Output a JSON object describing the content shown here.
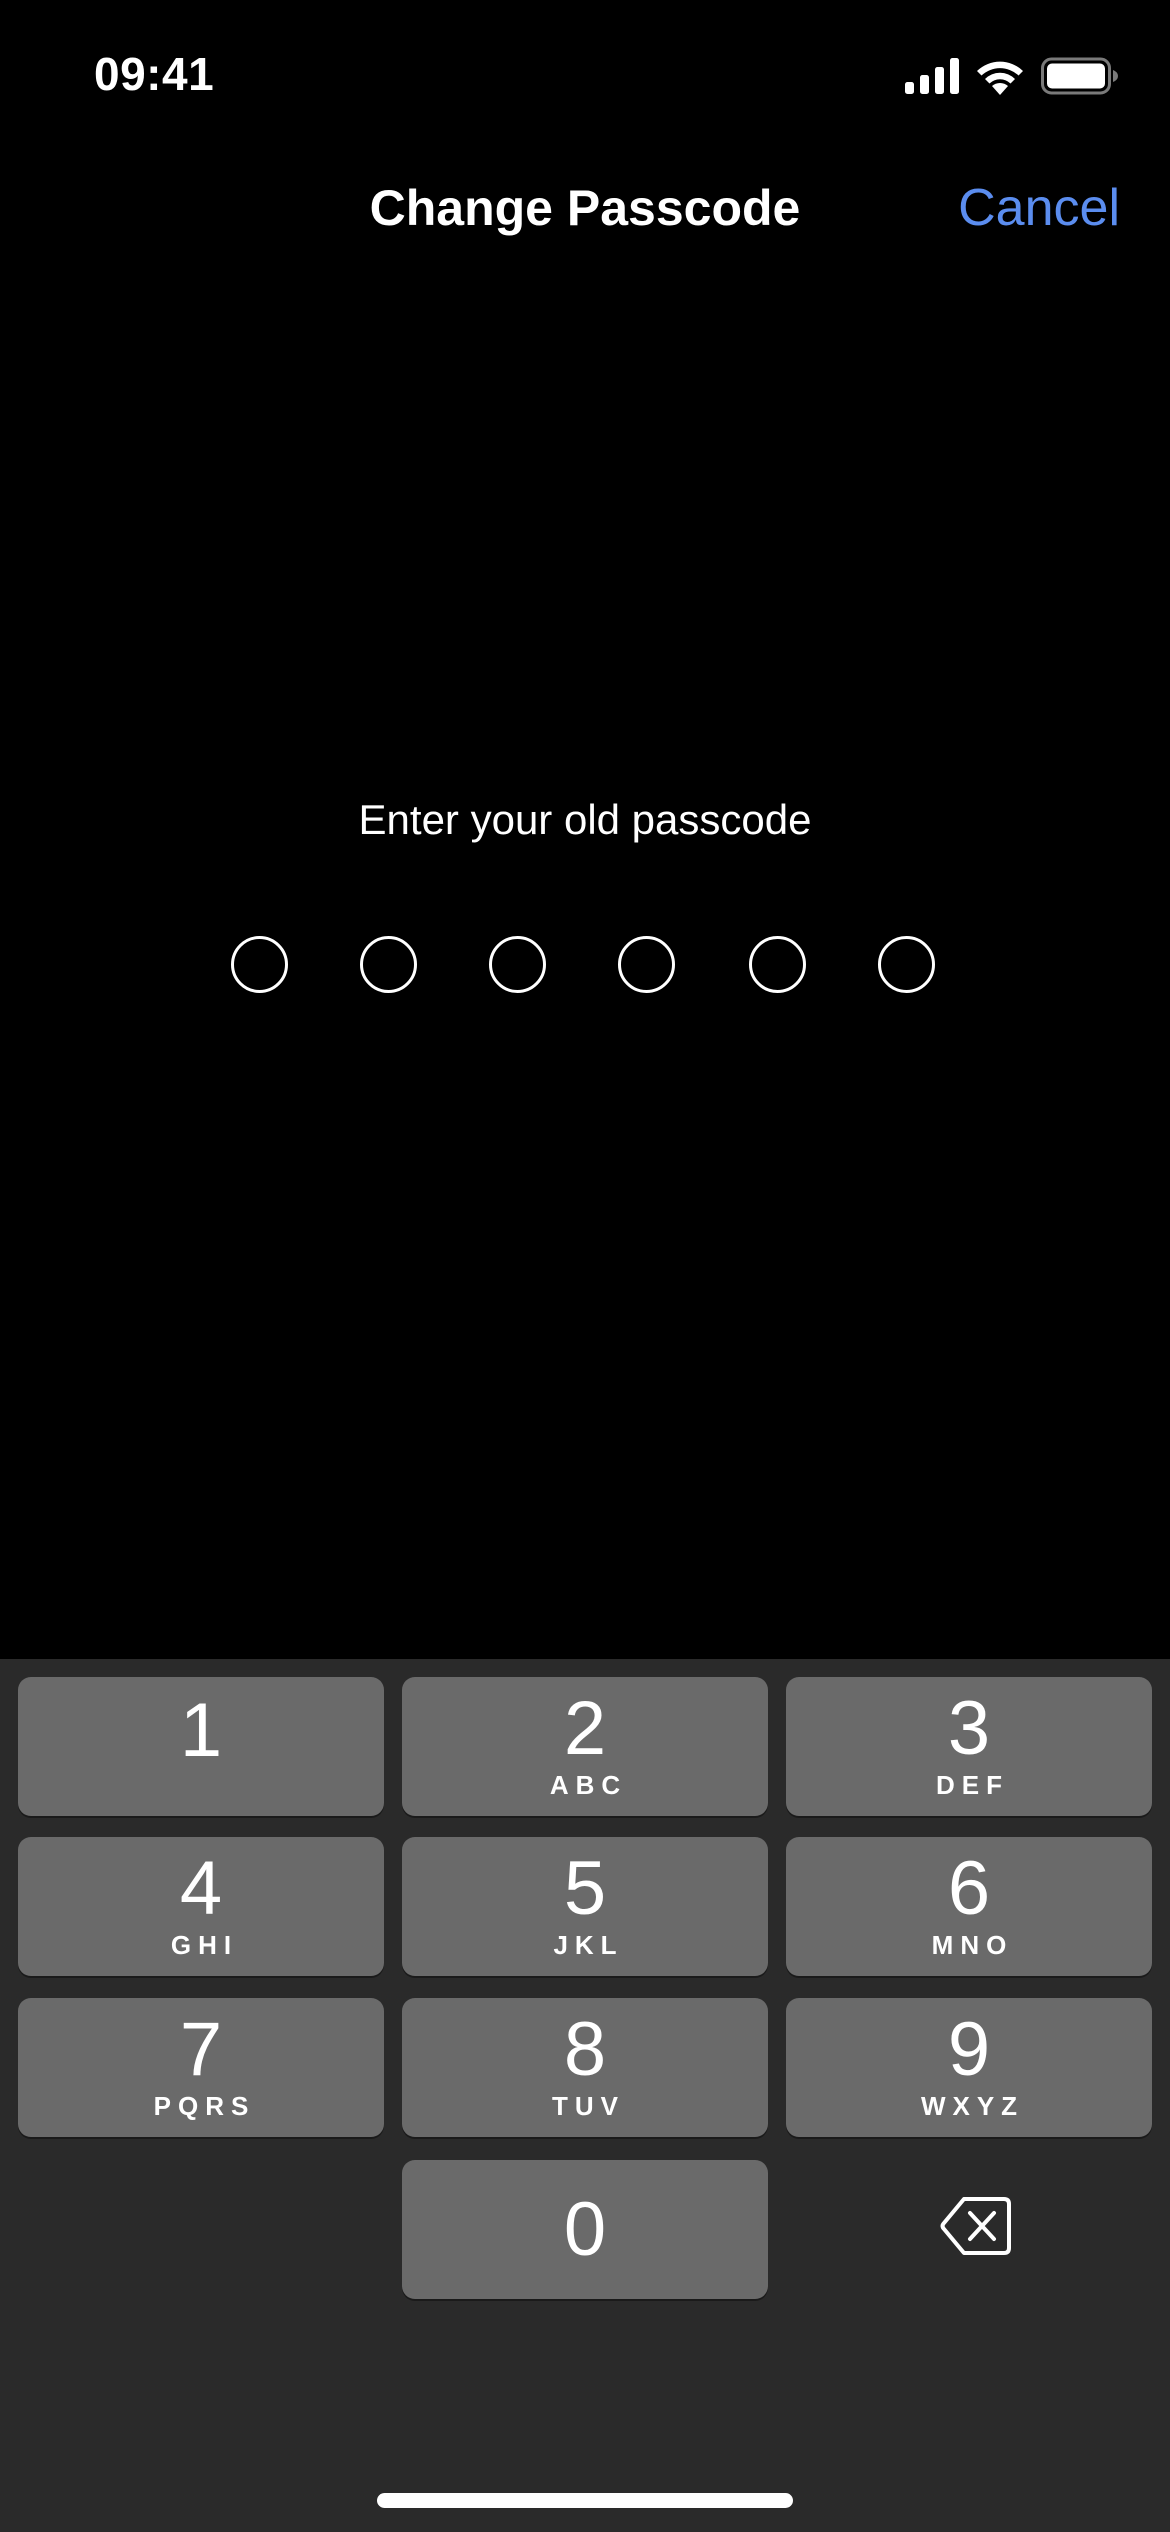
{
  "status_bar": {
    "time": "09:41",
    "icons": [
      "cellular-signal-icon",
      "wifi-icon",
      "battery-icon"
    ]
  },
  "nav": {
    "title": "Change Passcode",
    "cancel_label": "Cancel",
    "accent_color": "#5b8def"
  },
  "passcode": {
    "prompt": "Enter your old passcode",
    "length": 6,
    "entered": 0
  },
  "keypad": {
    "keys": [
      {
        "digit": "1",
        "letters": ""
      },
      {
        "digit": "2",
        "letters": "ABC"
      },
      {
        "digit": "3",
        "letters": "DEF"
      },
      {
        "digit": "4",
        "letters": "GHI"
      },
      {
        "digit": "5",
        "letters": "JKL"
      },
      {
        "digit": "6",
        "letters": "MNO"
      },
      {
        "digit": "7",
        "letters": "PQRS"
      },
      {
        "digit": "8",
        "letters": "TUV"
      },
      {
        "digit": "9",
        "letters": "WXYZ"
      },
      {
        "digit": "0",
        "letters": ""
      }
    ],
    "backspace_icon": "delete-backward-icon"
  },
  "colors": {
    "background": "#000000",
    "keypad_background": "#2a2a2a",
    "key_background": "#6a6a6a",
    "text": "#ffffff"
  }
}
